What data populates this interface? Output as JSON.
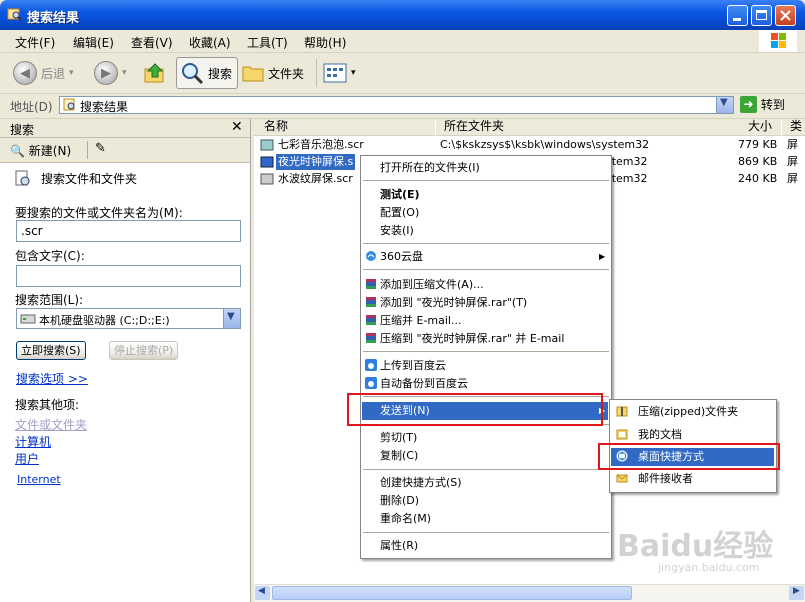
{
  "window": {
    "title": "搜索结果"
  },
  "menu": [
    "文件(F)",
    "编辑(E)",
    "查看(V)",
    "收藏(A)",
    "工具(T)",
    "帮助(H)"
  ],
  "toolbar": {
    "back": "后退",
    "search": "搜索",
    "folders": "文件夹"
  },
  "address": {
    "label": "地址(D)",
    "value": "搜索结果",
    "go": "转到"
  },
  "search_pane": {
    "title": "搜索",
    "new_label": "新建(N)",
    "heading": "搜索文件和文件夹",
    "name_label": "要搜索的文件或文件夹名为(M):",
    "name_value": ".scr",
    "text_label": "包含文字(C):",
    "text_value": "",
    "scope_label": "搜索范围(L):",
    "scope_value": "本机硬盘驱动器 (C:;D:;E:)",
    "search_now": "立即搜索(S)",
    "stop_search": "停止搜索(P)",
    "options_link": "搜索选项 >>",
    "other_heading": "搜索其他项:",
    "other_items": [
      "文件或文件夹",
      "计算机",
      "用户"
    ],
    "internet_link": "Internet"
  },
  "columns": {
    "name": "名称",
    "folder": "所在文件夹",
    "size": "大小",
    "type": "类"
  },
  "files": [
    {
      "name": "七彩音乐泡泡.scr",
      "folder": "C:\\$kskzsys$\\ksbk\\windows\\system32",
      "size": "779 KB",
      "type": "屏"
    },
    {
      "name": "夜光时钟屏保.s",
      "folder": "stem32",
      "size": "869 KB",
      "type": "屏"
    },
    {
      "name": "水波纹屏保.scr",
      "folder": "stem32",
      "size": "240 KB",
      "type": "屏"
    }
  ],
  "context_menu": {
    "open_folder": "打开所在的文件夹(I)",
    "test": "测试(E)",
    "configure": "配置(O)",
    "install": "安装(I)",
    "cloud360": "360云盘",
    "add_archive": "添加到压缩文件(A)...",
    "add_named": "添加到 \"夜光时钟屏保.rar\"(T)",
    "compress_email": "压缩并 E-mail...",
    "compress_named_email": "压缩到 \"夜光时钟屏保.rar\" 并 E-mail",
    "upload_baidu": "上传到百度云",
    "auto_backup": "自动备份到百度云",
    "send_to": "发送到(N)",
    "cut": "剪切(T)",
    "copy": "复制(C)",
    "create_shortcut": "创建快捷方式(S)",
    "delete": "删除(D)",
    "rename": "重命名(M)",
    "properties": "属性(R)"
  },
  "sendto_menu": [
    "压缩(zipped)文件夹",
    "我的文档",
    "桌面快捷方式",
    "邮件接收者"
  ],
  "watermark": {
    "brand": "Baidu经验",
    "url": "jingyan.baidu.com"
  },
  "colors": {
    "title_bar": "#0a58e2",
    "highlight": "#316ac5",
    "red_box": "#e0181b",
    "link": "#0033cc"
  }
}
